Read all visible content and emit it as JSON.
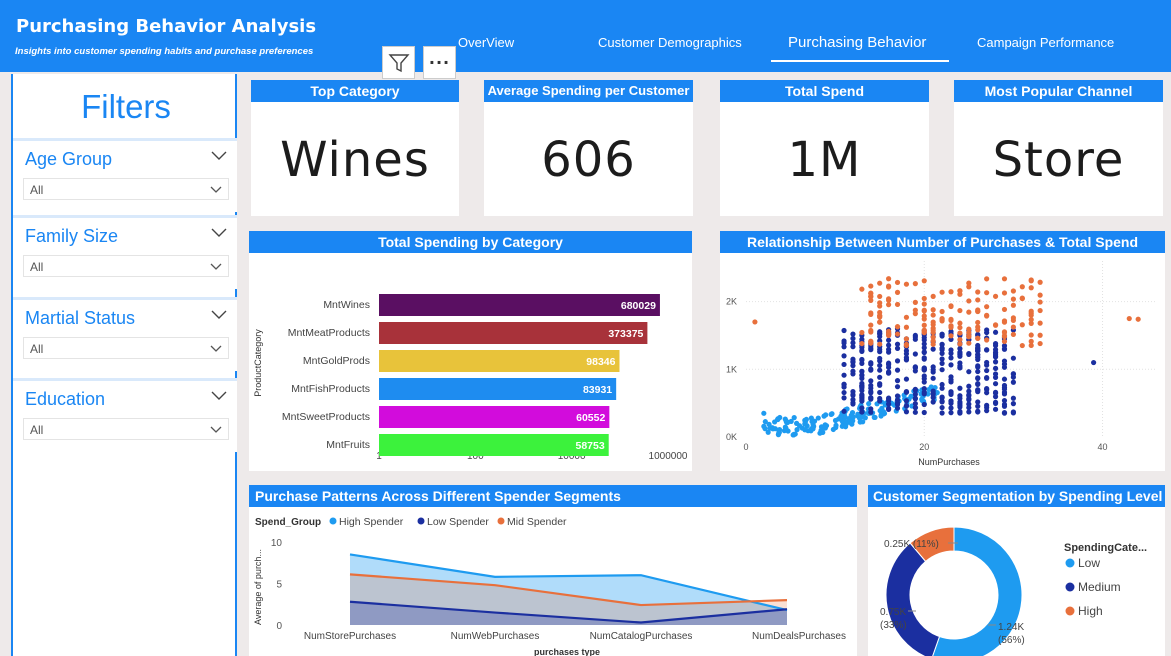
{
  "header": {
    "title": "Purchasing Behavior Analysis",
    "subtitle": "Insights into customer spending habits and purchase preferences",
    "tabs": [
      {
        "label": "OverView"
      },
      {
        "label": "Customer Demographics"
      },
      {
        "label": "Purchasing Behavior"
      },
      {
        "label": "Campaign Performance"
      }
    ],
    "active_tab": "Purchasing Behavior",
    "more_label": "···"
  },
  "sidebar": {
    "title": "Filters",
    "filters": [
      {
        "label": "Age Group",
        "value": "All"
      },
      {
        "label": "Family Size",
        "value": "All"
      },
      {
        "label": "Martial Status",
        "value": "All"
      },
      {
        "label": "Education",
        "value": "All"
      }
    ]
  },
  "kpis": [
    {
      "title": "Top Category",
      "value": "Wines"
    },
    {
      "title": "Average Spending per Customer",
      "value": "606"
    },
    {
      "title": "Total Spend",
      "value": "1M"
    },
    {
      "title": "Most Popular Channel",
      "value": "Store"
    }
  ],
  "colors": {
    "accent": "#1a86f3",
    "low": "#1e9bf0",
    "medium": "#1b2fa0",
    "high": "#e8703c"
  },
  "chart_data": [
    {
      "type": "bar",
      "title": "Total Spending by Category",
      "ylabel": "ProductCategory",
      "scale": "log",
      "categories": [
        "MntWines",
        "MntMeatProducts",
        "MntGoldProds",
        "MntFishProducts",
        "MntSweetProducts",
        "MntFruits"
      ],
      "values": [
        680029,
        373375,
        98346,
        83931,
        60552,
        58753
      ],
      "colors": [
        "#5a0f62",
        "#a8323a",
        "#e8c33a",
        "#1e8cf0",
        "#d20cdc",
        "#3cf23c"
      ],
      "xticks": [
        "1",
        "100",
        "10000",
        "1000000"
      ]
    },
    {
      "type": "scatter",
      "title": "Relationship Between Number of Purchases & Total Spend",
      "xlabel": "NumPurchases",
      "xticks": [
        "0",
        "20",
        "40"
      ],
      "yticks": [
        "0K",
        "1K",
        "2K"
      ],
      "xlim": [
        0,
        46
      ],
      "ylim": [
        0,
        2600
      ],
      "groups": [
        "Low",
        "Medium",
        "High"
      ]
    },
    {
      "type": "area",
      "title": "Purchase Patterns Across Different Spender Segments",
      "legend_title": "Spend_Group",
      "xlabel": "purchases type",
      "ylabel": "Average of purch...",
      "categories": [
        "NumStorePurchases",
        "NumWebPurchases",
        "NumCatalogPurchases",
        "NumDealsPurchases"
      ],
      "ylim": [
        0,
        10
      ],
      "yticks": [
        "0",
        "5",
        "10"
      ],
      "series": [
        {
          "name": "High Spender",
          "values": [
            8.5,
            5.8,
            6.0,
            1.8
          ]
        },
        {
          "name": "Low Spender",
          "values": [
            2.8,
            1.5,
            0.3,
            1.9
          ]
        },
        {
          "name": "Mid Spender",
          "values": [
            6.1,
            4.8,
            2.4,
            3.0
          ]
        }
      ]
    },
    {
      "type": "pie",
      "title": "Customer Segmentation by Spending Level",
      "legend_title": "SpendingCate...",
      "slices": [
        {
          "name": "Low",
          "value": 1.24,
          "label": "1.24K",
          "pct": "(56%)"
        },
        {
          "name": "Medium",
          "value": 0.75,
          "label": "0.75K",
          "pct": "(33%)"
        },
        {
          "name": "High",
          "value": 0.25,
          "label": "0.25K (11%)",
          "pct": ""
        }
      ]
    }
  ]
}
